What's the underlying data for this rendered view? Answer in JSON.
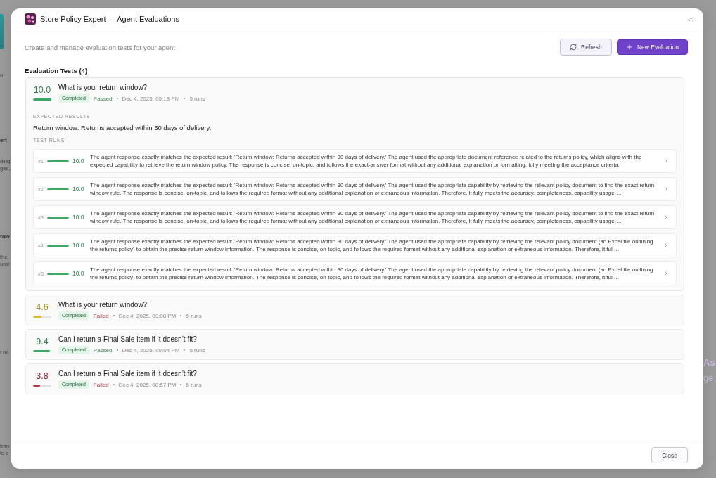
{
  "background": {
    "left_blocks": [
      {
        "lines": [
          {
            "text": "6",
            "kind": "text"
          }
        ]
      },
      {
        "lines": [
          {
            "text": "ert",
            "kind": "heading"
          },
          {
            "text": "ding",
            "kind": "text"
          },
          {
            "text": "ges,",
            "kind": "text"
          }
        ]
      },
      {
        "lines": [
          {
            "text": "row",
            "kind": "heading"
          },
          {
            "text": "the",
            "kind": "text"
          },
          {
            "text": "urat",
            "kind": "text"
          }
        ]
      },
      {
        "lines": [
          {
            "text": "t ha",
            "kind": "text"
          }
        ]
      },
      {
        "lines": [
          {
            "text": "tran",
            "kind": "text"
          },
          {
            "text": "to e",
            "kind": "text"
          }
        ]
      }
    ],
    "right_lines": [
      {
        "text": "As",
        "kind": "title"
      },
      {
        "text": "ge",
        "kind": "subtitle"
      }
    ]
  },
  "dialog": {
    "app_name": "Store Policy Expert",
    "separator": "-",
    "title": "Agent Evaluations",
    "subtitle": "Create and manage evaluation tests for your agent",
    "buttons": [
      {
        "label": "Refresh",
        "kind": "secondary"
      },
      {
        "label": "New Evaluation",
        "kind": "primary"
      }
    ],
    "section_title": "Evaluation Tests (4)",
    "evaluations": [
      {
        "score": "10.0",
        "level": 1,
        "title": "What is your return window?",
        "status": "Completed",
        "outcome": "Passed",
        "passed": true,
        "date": "Dec 4, 2025, 09:18 PM",
        "runs_count": "5 runs",
        "expanded": true,
        "details": {
          "expected_label": "EXPECTED RESULTS",
          "expected": "Return window: Returns accepted within 30 days of delivery.",
          "runs_label": "TEST RUNS",
          "runs": [
            {
              "number": "#1",
              "level": 1,
              "score": "10.0",
              "text": "The agent response exactly matches the expected result: 'Return window: Returns accepted within 30 days of delivery.' The agent used the appropriate document reference related to the returns policy, which aligns with the expected capability to retrieve the return window policy. The response is concise, on-topic, and follows the exact-answer format without any additional explanation or formatting, fully meeting the acceptance criteria."
            },
            {
              "number": "#2",
              "level": 1,
              "score": "10.0",
              "text": "The agent response exactly matches the expected result: 'Return window: Returns accepted within 30 days of delivery.' The agent used the appropriate capability by retrieving the relevant policy document to find the exact return window rule. The response is concise, on-topic, and follows the required format without any additional explanation or extraneous information. Therefore, it fully meets the accuracy, completeness, capability usage,…"
            },
            {
              "number": "#3",
              "level": 1,
              "score": "10.0",
              "text": "The agent response exactly matches the expected result: 'Return window: Returns accepted within 30 days of delivery.' The agent used the appropriate capability by retrieving the relevant policy document to find the exact return window rule. The response is concise, on-topic, and follows the required format without any additional explanation or extraneous information. Therefore, it fully meets the accuracy, completeness, capability usage,…"
            },
            {
              "number": "#4",
              "level": 1,
              "score": "10.0",
              "text": "The agent response exactly matches the expected result: 'Return window: Returns accepted within 30 days of delivery.' The agent used the appropriate capability by retrieving the relevant policy document (an Excel file outlining the returns policy) to obtain the precise return window information. The response is concise, on-topic, and follows the required format without any additional explanation or extraneous information. Therefore, it full…"
            },
            {
              "number": "#5",
              "level": 1,
              "score": "10.0",
              "text": "The agent response exactly matches the expected result: 'Return window: Returns accepted within 30 days of delivery.' The agent used the appropriate capability by retrieving the relevant policy document (an Excel file outlining the returns policy) to obtain the precise return window information. The response is concise, on-topic, and follows the required format without any additional explanation or extraneous information. Therefore, it full…"
            }
          ]
        }
      },
      {
        "score": "4.6",
        "level": 0.46,
        "title": "What is your return window?",
        "status": "Completed",
        "outcome": "Failed",
        "passed": false,
        "date": "Dec 4, 2025, 09:08 PM",
        "runs_count": "5 runs",
        "expanded": false
      },
      {
        "score": "9.4",
        "level": 0.94,
        "title": "Can I return a Final Sale item if it doesn’t fit?",
        "status": "Completed",
        "outcome": "Passed",
        "passed": true,
        "date": "Dec 4, 2025, 09:04 PM",
        "runs_count": "5 runs",
        "expanded": false
      },
      {
        "score": "3.8",
        "level": 0.38,
        "title": "Can I return a Final Sale item if it doesn’t fit?",
        "status": "Completed",
        "outcome": "Failed",
        "passed": false,
        "date": "Dec 4, 2025, 08:57 PM",
        "runs_count": "5 runs",
        "expanded": false
      }
    ],
    "footer_button": "Close"
  }
}
